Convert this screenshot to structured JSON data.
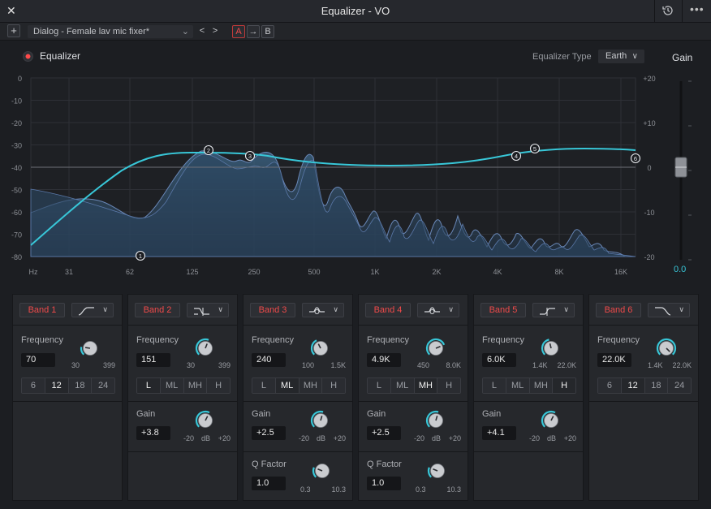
{
  "window": {
    "title": "Equalizer - VO"
  },
  "icons": {
    "close": "close-icon",
    "history": "history-icon",
    "more": "more-icon",
    "add": "plus-icon"
  },
  "presets": {
    "add_label": "+",
    "current": "Dialog - Female lav mic fixer*",
    "prev": "<",
    "next": ">",
    "a": "A",
    "copy": "→",
    "b": "B"
  },
  "header": {
    "eq_label": "Equalizer",
    "eq_on": true,
    "type_label": "Equalizer Type",
    "type_value": "Earth",
    "gain_label": "Gain",
    "gain_value": "0.0",
    "gain_level_db": 0
  },
  "graph": {
    "left_ticks": [
      "0",
      "-10",
      "-20",
      "-30",
      "-40",
      "-50",
      "-60",
      "-70",
      "-80"
    ],
    "right_ticks": [
      "+20",
      "+10",
      "0",
      "-10",
      "-20"
    ],
    "freq_ticks": [
      "Hz",
      "31",
      "62",
      "125",
      "250",
      "500",
      "1K",
      "2K",
      "4K",
      "8K",
      "16K"
    ],
    "nodes": [
      "1",
      "2",
      "3",
      "4",
      "5",
      "6"
    ]
  },
  "colors": {
    "accent": "#38c7d8",
    "band_red": "#ef4a4a",
    "bg": "#1c1e22"
  },
  "bands": [
    {
      "label": "Band 1",
      "shape": "high-pass",
      "freq_label": "Frequency",
      "freq": "70",
      "freq_min": "30",
      "freq_max": "399",
      "freq_pos": 0.2,
      "slopes": [
        "6",
        "12",
        "18",
        "24"
      ],
      "active_slope": 1
    },
    {
      "label": "Band 2",
      "shape": "low-shelf",
      "freq_label": "Frequency",
      "freq": "151",
      "freq_min": "30",
      "freq_max": "399",
      "freq_pos": 0.58,
      "modes": [
        "L",
        "ML",
        "MH",
        "H"
      ],
      "active_mode": 0,
      "gain_label": "Gain",
      "gain": "+3.8",
      "gain_min": "-20",
      "gain_unit": "dB",
      "gain_max": "+20",
      "gain_pos": 0.6
    },
    {
      "label": "Band 3",
      "shape": "bell",
      "freq_label": "Frequency",
      "freq": "240",
      "freq_min": "100",
      "freq_max": "1.5K",
      "freq_pos": 0.4,
      "modes": [
        "L",
        "ML",
        "MH",
        "H"
      ],
      "active_mode": 1,
      "gain_label": "Gain",
      "gain": "+2.5",
      "gain_min": "-20",
      "gain_unit": "dB",
      "gain_max": "+20",
      "gain_pos": 0.56,
      "q_label": "Q Factor",
      "q": "1.0",
      "q_min": "0.3",
      "q_max": "10.3",
      "q_pos": 0.25
    },
    {
      "label": "Band 4",
      "shape": "bell",
      "freq_label": "Frequency",
      "freq": "4.9K",
      "freq_min": "450",
      "freq_max": "8.0K",
      "freq_pos": 0.75,
      "modes": [
        "L",
        "ML",
        "MH",
        "H"
      ],
      "active_mode": 2,
      "gain_label": "Gain",
      "gain": "+2.5",
      "gain_min": "-20",
      "gain_unit": "dB",
      "gain_max": "+20",
      "gain_pos": 0.56,
      "q_label": "Q Factor",
      "q": "1.0",
      "q_min": "0.3",
      "q_max": "10.3",
      "q_pos": 0.25
    },
    {
      "label": "Band 5",
      "shape": "high-shelf",
      "freq_label": "Frequency",
      "freq": "6.0K",
      "freq_min": "1.4K",
      "freq_max": "22.0K",
      "freq_pos": 0.45,
      "modes": [
        "L",
        "ML",
        "MH",
        "H"
      ],
      "active_mode": 3,
      "gain_label": "Gain",
      "gain": "+4.1",
      "gain_min": "-20",
      "gain_unit": "dB",
      "gain_max": "+20",
      "gain_pos": 0.6
    },
    {
      "label": "Band 6",
      "shape": "low-pass",
      "freq_label": "Frequency",
      "freq": "22.0K",
      "freq_min": "1.4K",
      "freq_max": "22.0K",
      "freq_pos": 1.0,
      "slopes": [
        "6",
        "12",
        "18",
        "24"
      ],
      "active_slope": 1
    }
  ]
}
